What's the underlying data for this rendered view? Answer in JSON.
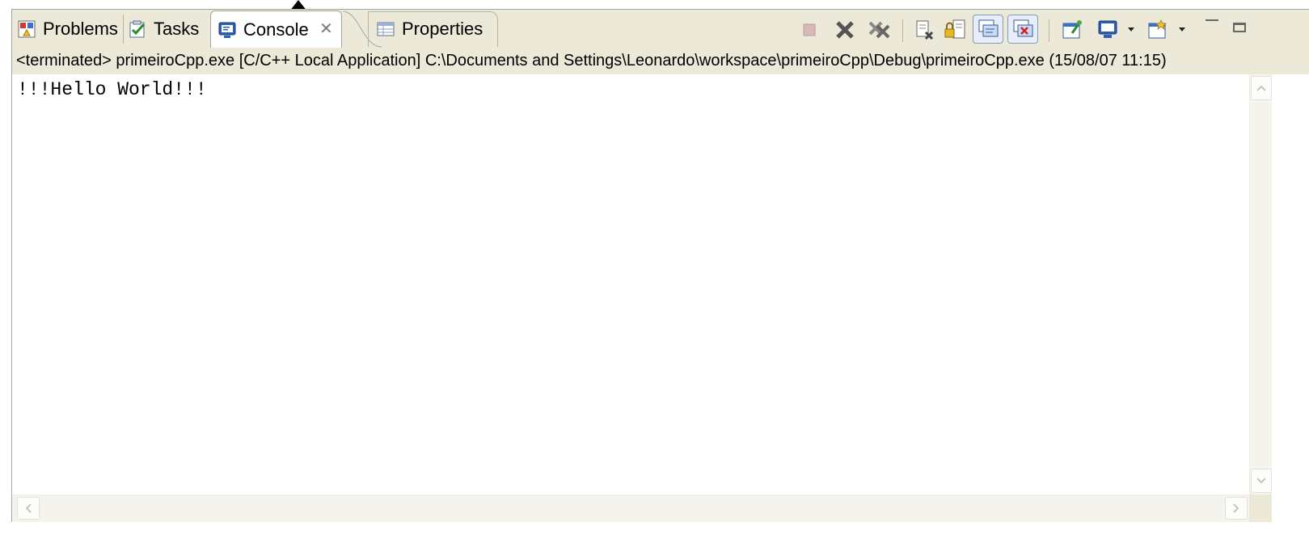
{
  "tabs": [
    {
      "label": "Problems",
      "icon": "problems-icon"
    },
    {
      "label": "Tasks",
      "icon": "tasks-icon"
    },
    {
      "label": "Console",
      "icon": "console-icon",
      "active": true
    },
    {
      "label": "Properties",
      "icon": "properties-icon"
    }
  ],
  "toolbar": {
    "icons": [
      "terminate-icon",
      "remove-launch-icon",
      "remove-all-terminated-icon",
      "clear-console-icon",
      "scroll-lock-icon",
      "show-on-stdout-icon",
      "show-on-stderr-icon",
      "pin-console-icon",
      "display-console-icon",
      "open-console-icon",
      "minimize-icon",
      "maximize-icon"
    ]
  },
  "process_label": "<terminated> primeiroCpp.exe [C/C++ Local Application] C:\\Documents and Settings\\Leonardo\\workspace\\primeiroCpp\\Debug\\primeiroCpp.exe (15/08/07 11:15)",
  "console_output": "!!!Hello World!!!",
  "colors": {
    "panel_bg": "#ece9d8",
    "border": "#a5a59a",
    "console_bg": "#ffffff"
  }
}
